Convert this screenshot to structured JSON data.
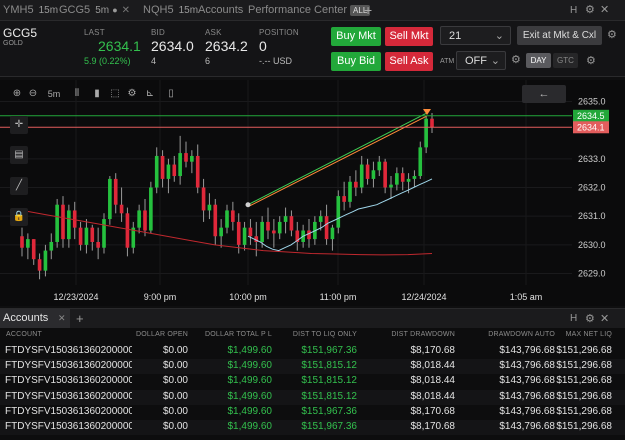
{
  "tabs": [
    {
      "symbol": "YMH5",
      "tf": "15m",
      "active": false
    },
    {
      "symbol": "GCG5",
      "tf": "5m",
      "active": true
    },
    {
      "symbol": "NQH5",
      "tf": "15m",
      "active": false
    },
    {
      "symbol": "Accounts",
      "tf": "",
      "active": false
    },
    {
      "symbol": "Performance Center",
      "tf": "",
      "active": false
    }
  ],
  "tab_badge": "ALL",
  "quote": {
    "symbol": "GCG5",
    "name": "GOLD",
    "last_label": "LAST",
    "last": "2634.1",
    "change": "5.9 (0.22%)",
    "bid_label": "BID",
    "bid": "2634.0",
    "bid_size": "4",
    "ask_label": "ASK",
    "ask": "2634.2",
    "ask_size": "6",
    "pos_label": "POSITION",
    "pos": "0",
    "pos_usd": "-.-- USD"
  },
  "orders": {
    "buy_mkt": "Buy Mkt",
    "sell_mkt": "Sell Mkt",
    "buy_bid": "Buy Bid",
    "sell_ask": "Sell Ask",
    "qty": "21",
    "atm_label": "ATM",
    "atm_value": "OFF",
    "exit_btn": "Exit at Mkt & Cxl",
    "day": "DAY",
    "gtc": "GTC"
  },
  "chart_tools": {
    "timeframe": "5m"
  },
  "chart_data": {
    "type": "candlestick",
    "y_ticks": [
      "2635.0",
      "2633.0",
      "2632.0",
      "2631.0",
      "2630.0",
      "2629.0"
    ],
    "x_ticks": [
      "12/23/2024",
      "9:00 pm",
      "10:00 pm",
      "11:00 pm",
      "12/24/2024",
      "1:05 am"
    ],
    "ylim": [
      2628.6,
      2635.4
    ],
    "price_tags": [
      {
        "label": "2634.5",
        "value": 2634.5,
        "color": "#22a83a"
      },
      {
        "label": "2634.1",
        "value": 2634.1,
        "color": "#e35d5d"
      }
    ],
    "candles": [
      [
        2630.3,
        2630.6,
        2629.6,
        2629.9
      ],
      [
        2629.9,
        2630.4,
        2629.5,
        2630.2
      ],
      [
        2630.2,
        2630.2,
        2629.3,
        2629.5
      ],
      [
        2629.5,
        2629.7,
        2628.8,
        2629.1
      ],
      [
        2629.1,
        2630.0,
        2628.9,
        2629.8
      ],
      [
        2629.8,
        2630.4,
        2629.5,
        2630.1
      ],
      [
        2630.1,
        2631.6,
        2629.9,
        2631.4
      ],
      [
        2631.4,
        2631.7,
        2629.9,
        2630.2
      ],
      [
        2630.2,
        2631.4,
        2629.9,
        2631.2
      ],
      [
        2631.2,
        2631.5,
        2630.2,
        2630.6
      ],
      [
        2630.6,
        2630.8,
        2629.8,
        2630.0
      ],
      [
        2630.0,
        2630.9,
        2629.7,
        2630.6
      ],
      [
        2630.6,
        2630.7,
        2629.8,
        2630.1
      ],
      [
        2630.1,
        2630.6,
        2629.5,
        2629.9
      ],
      [
        2629.9,
        2631.1,
        2629.7,
        2630.9
      ],
      [
        2630.9,
        2632.4,
        2630.7,
        2632.3
      ],
      [
        2632.3,
        2632.5,
        2631.1,
        2631.4
      ],
      [
        2631.4,
        2632.0,
        2630.8,
        2631.1
      ],
      [
        2631.1,
        2631.3,
        2629.6,
        2629.9
      ],
      [
        2629.9,
        2630.8,
        2629.7,
        2630.6
      ],
      [
        2630.6,
        2631.4,
        2630.4,
        2631.2
      ],
      [
        2631.2,
        2631.6,
        2630.3,
        2630.5
      ],
      [
        2630.5,
        2632.2,
        2630.4,
        2632.0
      ],
      [
        2632.0,
        2633.4,
        2631.8,
        2633.1
      ],
      [
        2633.1,
        2633.3,
        2632.0,
        2632.3
      ],
      [
        2632.3,
        2633.0,
        2631.8,
        2632.8
      ],
      [
        2632.8,
        2633.1,
        2632.2,
        2632.4
      ],
      [
        2632.4,
        2633.8,
        2632.1,
        2633.2
      ],
      [
        2633.2,
        2633.6,
        2632.7,
        2632.9
      ],
      [
        2632.9,
        2633.3,
        2632.5,
        2633.1
      ],
      [
        2633.1,
        2633.5,
        2631.8,
        2632.0
      ],
      [
        2632.0,
        2632.3,
        2630.8,
        2631.2
      ],
      [
        2631.2,
        2631.8,
        2630.9,
        2631.4
      ],
      [
        2631.4,
        2631.6,
        2630.0,
        2630.3
      ],
      [
        2630.3,
        2630.9,
        2629.9,
        2630.6
      ],
      [
        2630.6,
        2631.4,
        2630.4,
        2631.2
      ],
      [
        2631.2,
        2631.5,
        2630.5,
        2630.8
      ],
      [
        2630.8,
        2631.1,
        2629.7,
        2630.0
      ],
      [
        2630.0,
        2630.8,
        2629.8,
        2630.6
      ],
      [
        2630.6,
        2630.9,
        2630.0,
        2630.3
      ],
      [
        2630.3,
        2630.8,
        2629.6,
        2630.1
      ],
      [
        2630.1,
        2631.0,
        2629.9,
        2630.8
      ],
      [
        2630.8,
        2631.3,
        2630.2,
        2630.5
      ],
      [
        2630.5,
        2630.9,
        2629.9,
        2630.4
      ],
      [
        2630.4,
        2631.0,
        2630.2,
        2630.8
      ],
      [
        2630.8,
        2631.3,
        2630.4,
        2631.0
      ],
      [
        2631.0,
        2631.2,
        2630.3,
        2630.5
      ],
      [
        2630.5,
        2630.8,
        2629.8,
        2630.1
      ],
      [
        2630.1,
        2630.7,
        2629.9,
        2630.5
      ],
      [
        2630.5,
        2630.9,
        2629.9,
        2630.2
      ],
      [
        2630.2,
        2631.0,
        2630.0,
        2630.8
      ],
      [
        2630.8,
        2631.2,
        2630.5,
        2631.0
      ],
      [
        2631.0,
        2631.4,
        2630.0,
        2630.2
      ],
      [
        2630.2,
        2630.7,
        2629.8,
        2630.6
      ],
      [
        2630.6,
        2631.9,
        2630.4,
        2631.7
      ],
      [
        2631.7,
        2632.2,
        2631.2,
        2631.5
      ],
      [
        2631.5,
        2632.4,
        2631.3,
        2632.2
      ],
      [
        2632.2,
        2632.6,
        2631.7,
        2632.0
      ],
      [
        2632.0,
        2633.1,
        2631.8,
        2632.8
      ],
      [
        2632.8,
        2633.0,
        2632.1,
        2632.3
      ],
      [
        2632.3,
        2632.9,
        2632.0,
        2632.6
      ],
      [
        2632.6,
        2633.1,
        2632.4,
        2632.9
      ],
      [
        2632.9,
        2633.0,
        2631.8,
        2632.0
      ],
      [
        2632.0,
        2632.4,
        2631.6,
        2632.1
      ],
      [
        2632.1,
        2632.7,
        2631.9,
        2632.5
      ],
      [
        2632.5,
        2632.7,
        2631.9,
        2632.2
      ],
      [
        2632.2,
        2632.5,
        2631.8,
        2632.3
      ],
      [
        2632.3,
        2632.6,
        2632.0,
        2632.4
      ],
      [
        2632.4,
        2633.6,
        2632.3,
        2633.4
      ],
      [
        2633.4,
        2634.5,
        2633.2,
        2634.4
      ],
      [
        2634.4,
        2634.6,
        2633.9,
        2634.1
      ]
    ],
    "ma_blue": [
      2630.3,
      2630.2,
      2630.1,
      2629.95,
      2629.85,
      2629.8,
      2629.9,
      2630.0,
      2630.15,
      2630.3,
      2630.4,
      2630.5,
      2630.6,
      2630.75,
      2630.85,
      2630.95,
      2631.05,
      2631.15,
      2631.25,
      2631.3,
      2631.35,
      2631.4,
      2631.5,
      2631.6,
      2631.7,
      2631.8,
      2631.9,
      2632.0,
      2632.1,
      2632.2,
      2632.3
    ],
    "ma_red": [
      2631.2,
      2631.05,
      2630.9,
      2630.75,
      2630.6,
      2630.45,
      2630.3,
      2630.15,
      2630.0,
      2629.9,
      2629.8,
      2629.75,
      2629.7,
      2629.68,
      2629.66,
      2629.65,
      2629.66,
      2629.7
    ]
  },
  "accounts": {
    "tab": "Accounts",
    "columns": [
      "ACCOUNT",
      "DOLLAR OPEN",
      "DOLLAR TOTAL P L",
      "DIST TO LIQ ONLY",
      "DIST DRAWDOWN",
      "DRAWDOWN AUTO",
      "MAX NET LIQ"
    ],
    "rows": [
      [
        "FTDYSFV150361360200000",
        "$0.00",
        "$1,499.60",
        "$151,967.36",
        "$8,170.68",
        "$143,796.68",
        "$151,296.68"
      ],
      [
        "FTDYSFV150361360200000",
        "$0.00",
        "$1,499.60",
        "$151,815.12",
        "$8,018.44",
        "$143,796.68",
        "$151,296.68"
      ],
      [
        "FTDYSFV150361360200000",
        "$0.00",
        "$1,499.60",
        "$151,815.12",
        "$8,018.44",
        "$143,796.68",
        "$151,296.68"
      ],
      [
        "FTDYSFV150361360200000",
        "$0.00",
        "$1,499.60",
        "$151,815.12",
        "$8,018.44",
        "$143,796.68",
        "$151,296.68"
      ],
      [
        "FTDYSFV150361360200000",
        "$0.00",
        "$1,499.60",
        "$151,967.36",
        "$8,170.68",
        "$143,796.68",
        "$151,296.68"
      ],
      [
        "FTDYSFV150361360200000",
        "$0.00",
        "$1,499.60",
        "$151,967.36",
        "$8,170.68",
        "$143,796.68",
        "$151,296.68"
      ]
    ]
  }
}
